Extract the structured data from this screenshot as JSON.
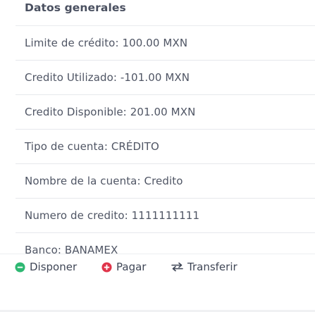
{
  "card": {
    "title": "Datos generales"
  },
  "details": [
    {
      "text": "Limite de crédito: 100.00 MXN"
    },
    {
      "text": "Credito Utilizado: -101.00 MXN"
    },
    {
      "text": "Credito Disponible: 201.00 MXN"
    },
    {
      "text": "Tipo de cuenta: CRÉDITO"
    },
    {
      "text": "Nombre de la cuenta: Credito"
    },
    {
      "text": "Numero de credito: 1111111111"
    },
    {
      "text": "Banco: BANAMEX"
    }
  ],
  "actions": {
    "disponer": {
      "label": "Disponer",
      "icon": "minus-circle-icon",
      "color": "#2eb872"
    },
    "pagar": {
      "label": "Pagar",
      "icon": "plus-circle-icon",
      "color": "#e0344a"
    },
    "transferir": {
      "label": "Transferir",
      "icon": "exchange-arrows-icon",
      "color": "#3f4656"
    }
  }
}
